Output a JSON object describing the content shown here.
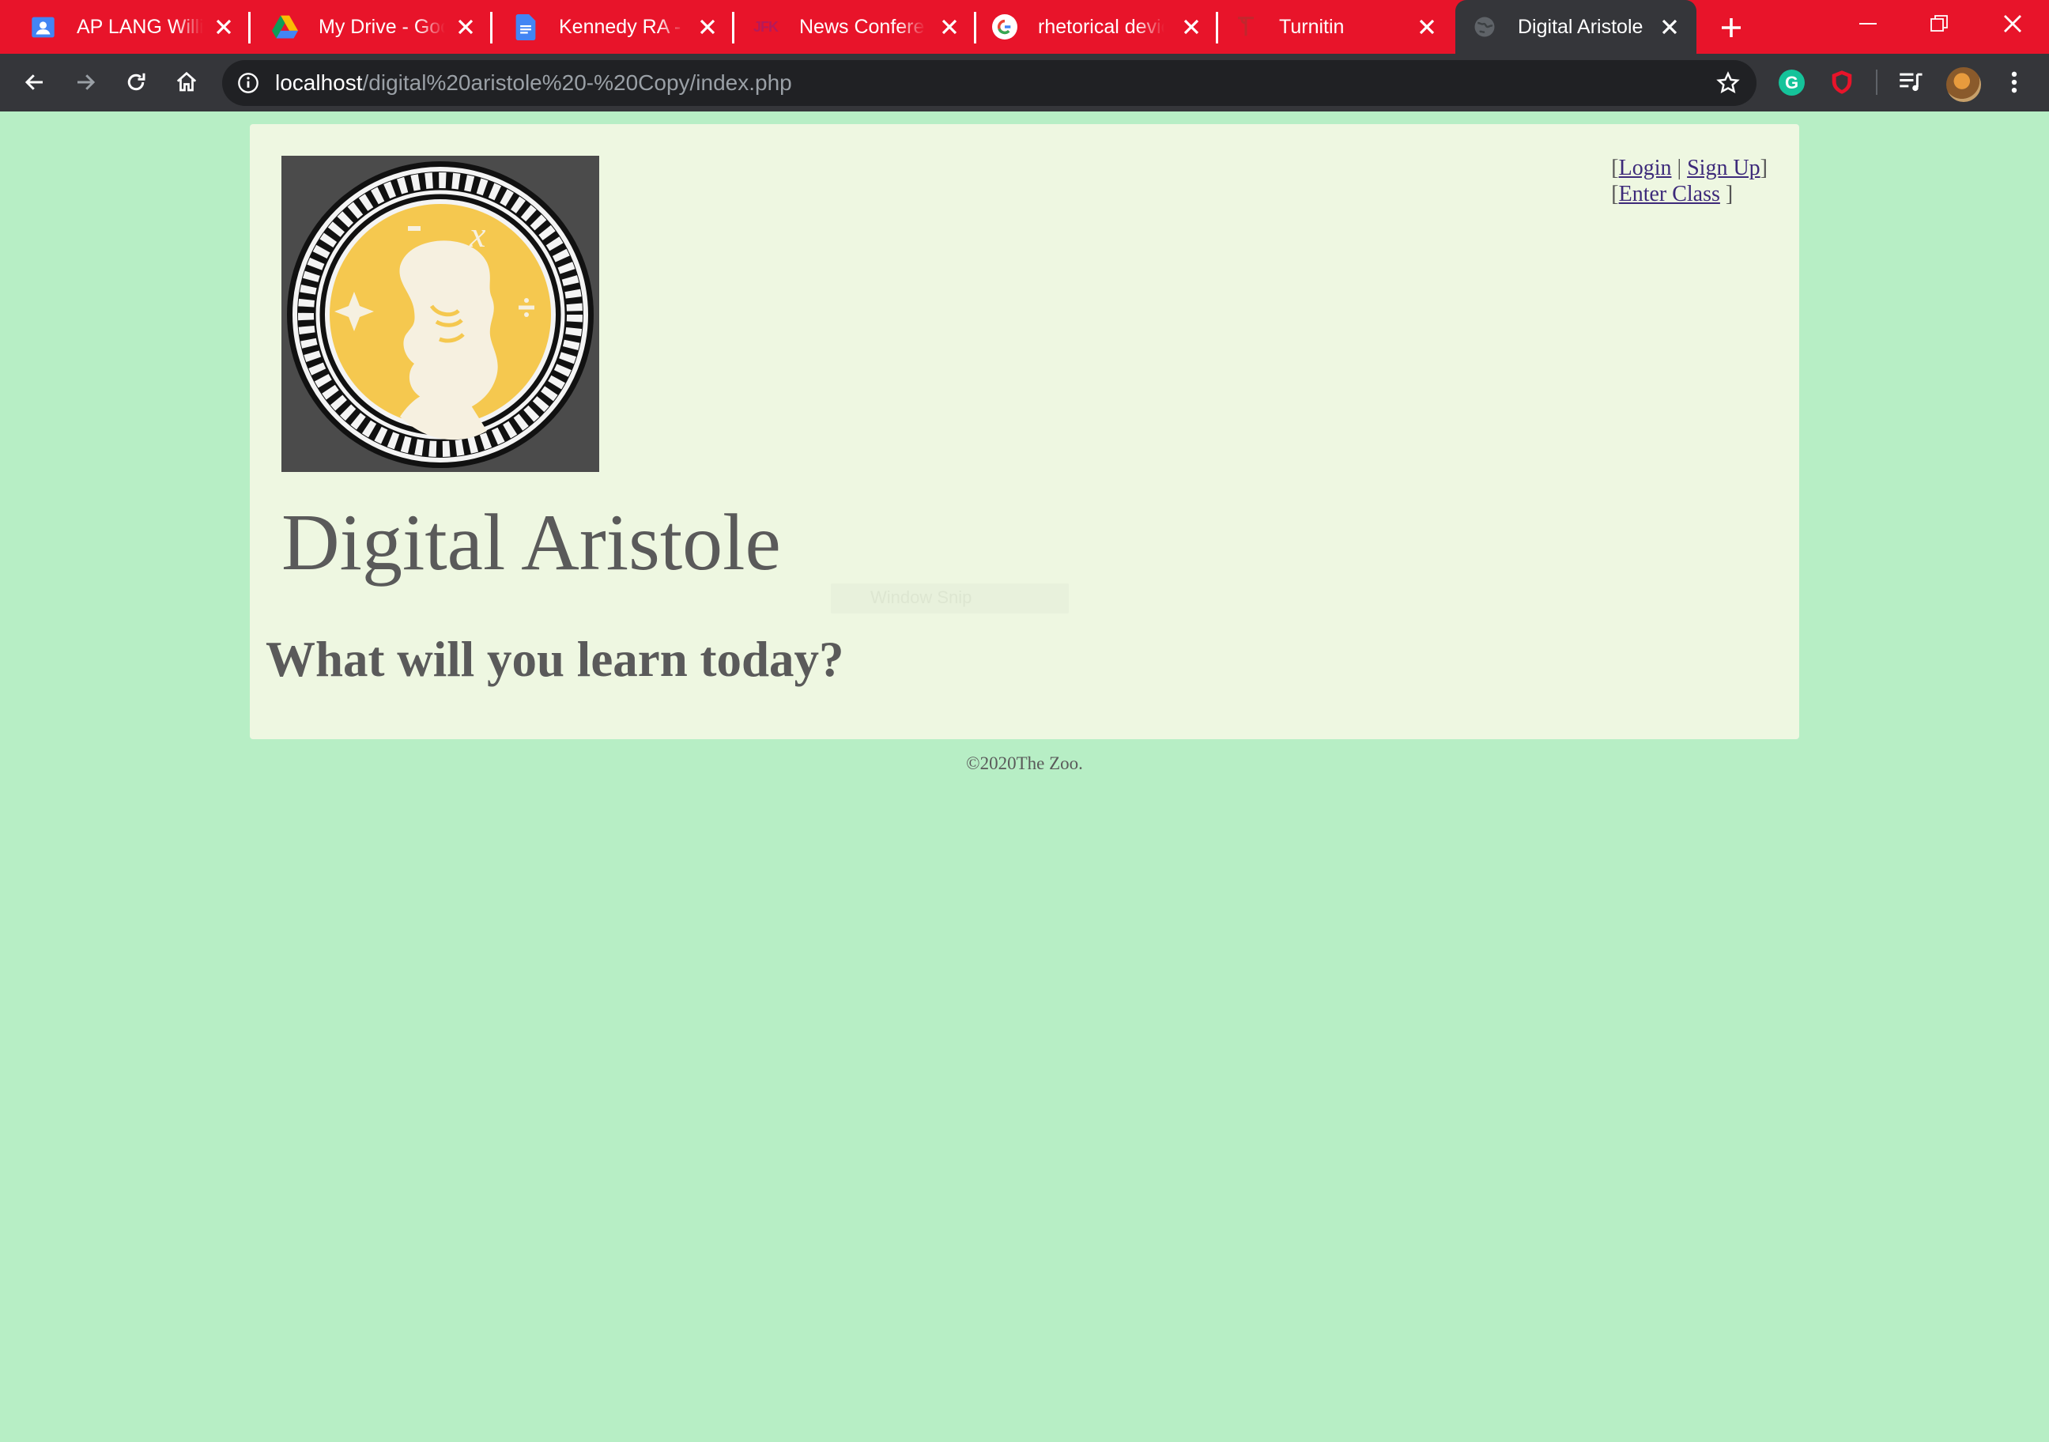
{
  "browser": {
    "tabs": [
      {
        "title": "AP LANG William",
        "favicon": "classroom-icon",
        "active": false
      },
      {
        "title": "My Drive - Google Drive",
        "favicon": "google-drive-icon",
        "active": false
      },
      {
        "title": "Kennedy RA - Google Docs",
        "favicon": "google-docs-icon",
        "active": false
      },
      {
        "title": "News Conference",
        "favicon": "jfk-library-icon",
        "active": false
      },
      {
        "title": "rhetorical devices",
        "favicon": "google-icon",
        "active": false
      },
      {
        "title": "Turnitin",
        "favicon": "turnitin-icon",
        "active": false
      },
      {
        "title": "Digital Aristole",
        "favicon": "globe-icon",
        "active": true
      }
    ],
    "address": {
      "host": "localhost",
      "path": "/digital%20aristole%20-%20Copy/index.php"
    },
    "colors": {
      "tabstrip": "#e8142a",
      "toolbar": "#35363a",
      "omnibox": "#202124"
    }
  },
  "page": {
    "logo_alt": "Aristotle medallion logo",
    "auth": {
      "open": "[",
      "login": "Login",
      "sep": " | ",
      "signup": "Sign Up",
      "close": "]",
      "open2": "[",
      "enter_class": "Enter Class",
      "close2": " ]"
    },
    "site_title": "Digital Aristole",
    "tagline": "What will you learn today?",
    "footer": "©2020The Zoo.",
    "colors": {
      "background": "#b7eec5",
      "card": "#eef7e1",
      "link": "#3d2a7a",
      "text": "#5a5a5a"
    }
  },
  "overlay": {
    "snip_label": "Window Snip"
  }
}
